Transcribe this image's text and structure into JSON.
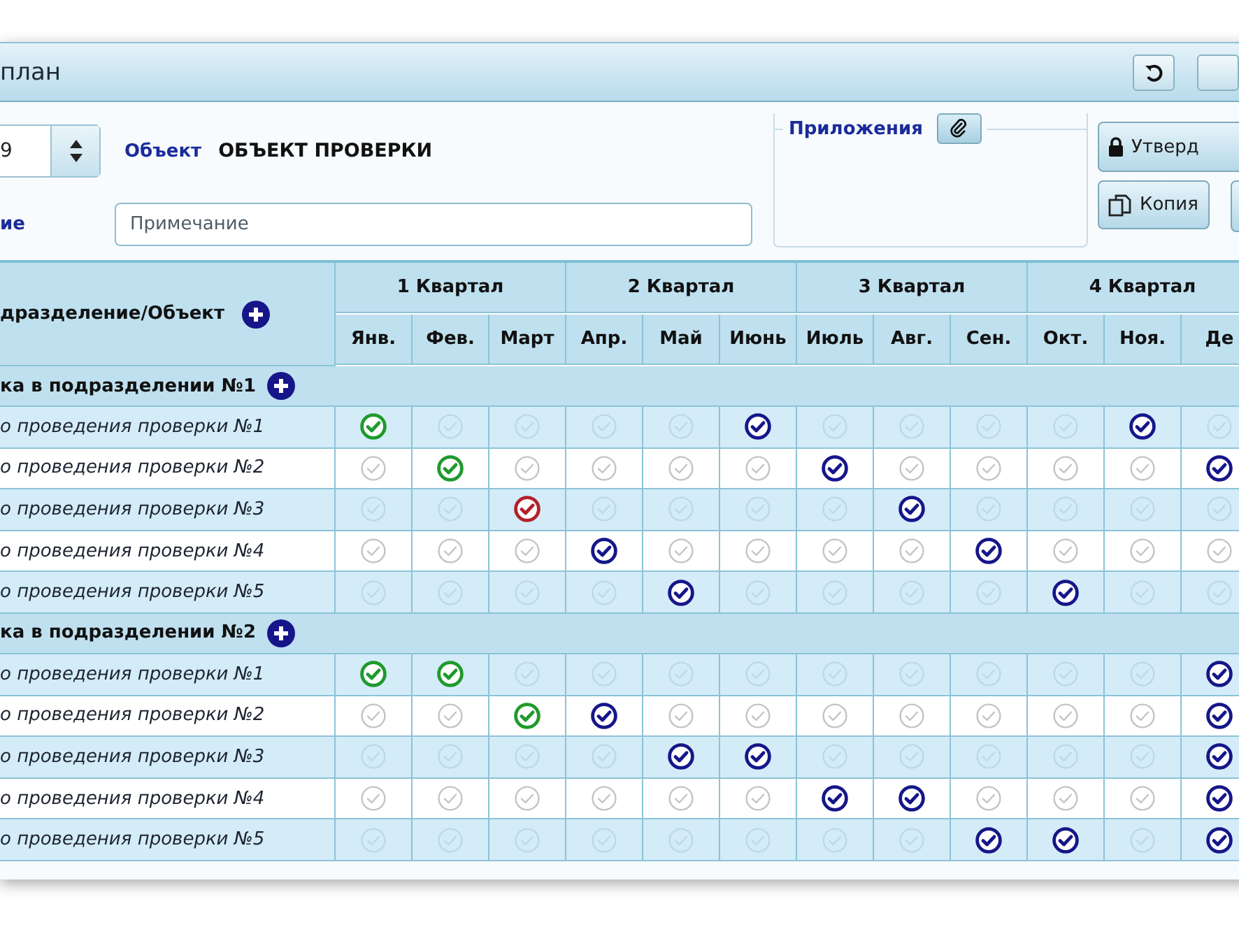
{
  "window": {
    "title": "план"
  },
  "form": {
    "year": {
      "value": "9"
    },
    "object": {
      "label": "Объект",
      "value": "ОБЪЕКТ ПРОВЕРКИ"
    },
    "note": {
      "label": "ие",
      "placeholder": "Примечание"
    },
    "attachments": {
      "label": "Приложения"
    },
    "actions": [
      {
        "label": "Утверд"
      },
      {
        "label": "Копия"
      }
    ]
  },
  "table": {
    "first_column": "дразделение/Объект",
    "quarters": [
      {
        "label": "1 Квартал",
        "months": [
          "Янв.",
          "Фев.",
          "Март"
        ]
      },
      {
        "label": "2 Квартал",
        "months": [
          "Апр.",
          "Май",
          "Июнь"
        ]
      },
      {
        "label": "3 Квартал",
        "months": [
          "Июль",
          "Авг.",
          "Сен."
        ]
      },
      {
        "label": "4 Квартал",
        "months": [
          "Окт.",
          "Ноя.",
          "Де"
        ]
      }
    ],
    "groups": [
      {
        "title": "ка в подразделении №1",
        "rows": [
          {
            "name": "о проведения проверки №1",
            "cells": [
              {
                "checked": true,
                "color": "#1f9a2c"
              },
              {
                "checked": false
              },
              {
                "checked": false
              },
              {
                "checked": false
              },
              {
                "checked": false
              },
              {
                "checked": true,
                "color": "#16168a"
              },
              {
                "checked": false
              },
              {
                "checked": false
              },
              {
                "checked": false
              },
              {
                "checked": false
              },
              {
                "checked": true,
                "color": "#16168a"
              },
              {
                "checked": false
              }
            ]
          },
          {
            "name": "о проведения проверки №2",
            "cells": [
              {
                "checked": false
              },
              {
                "checked": true,
                "color": "#1f9a2c"
              },
              {
                "checked": false
              },
              {
                "checked": false
              },
              {
                "checked": false
              },
              {
                "checked": false
              },
              {
                "checked": true,
                "color": "#16168a"
              },
              {
                "checked": false
              },
              {
                "checked": false
              },
              {
                "checked": false
              },
              {
                "checked": false
              },
              {
                "checked": true,
                "color": "#16168a"
              }
            ]
          },
          {
            "name": "о проведения проверки №3",
            "cells": [
              {
                "checked": false
              },
              {
                "checked": false
              },
              {
                "checked": true,
                "color": "#b3202a"
              },
              {
                "checked": false
              },
              {
                "checked": false
              },
              {
                "checked": false
              },
              {
                "checked": false
              },
              {
                "checked": true,
                "color": "#16168a"
              },
              {
                "checked": false
              },
              {
                "checked": false
              },
              {
                "checked": false
              },
              {
                "checked": false
              }
            ]
          },
          {
            "name": "о проведения проверки №4",
            "cells": [
              {
                "checked": false
              },
              {
                "checked": false
              },
              {
                "checked": false
              },
              {
                "checked": true,
                "color": "#16168a"
              },
              {
                "checked": false
              },
              {
                "checked": false
              },
              {
                "checked": false
              },
              {
                "checked": false
              },
              {
                "checked": true,
                "color": "#16168a"
              },
              {
                "checked": false
              },
              {
                "checked": false
              },
              {
                "checked": false
              }
            ]
          },
          {
            "name": "о проведения проверки №5",
            "cells": [
              {
                "checked": false
              },
              {
                "checked": false
              },
              {
                "checked": false
              },
              {
                "checked": false
              },
              {
                "checked": true,
                "color": "#16168a"
              },
              {
                "checked": false
              },
              {
                "checked": false
              },
              {
                "checked": false
              },
              {
                "checked": false
              },
              {
                "checked": true,
                "color": "#16168a"
              },
              {
                "checked": false
              },
              {
                "checked": false
              }
            ]
          }
        ]
      },
      {
        "title": "ка в подразделении №2",
        "rows": [
          {
            "name": "о проведения проверки №1",
            "cells": [
              {
                "checked": true,
                "color": "#1f9a2c"
              },
              {
                "checked": true,
                "color": "#1f9a2c"
              },
              {
                "checked": false
              },
              {
                "checked": false
              },
              {
                "checked": false
              },
              {
                "checked": false
              },
              {
                "checked": false
              },
              {
                "checked": false
              },
              {
                "checked": false
              },
              {
                "checked": false
              },
              {
                "checked": false
              },
              {
                "checked": true,
                "color": "#16168a"
              }
            ]
          },
          {
            "name": "о проведения проверки №2",
            "cells": [
              {
                "checked": false
              },
              {
                "checked": false
              },
              {
                "checked": true,
                "color": "#1f9a2c"
              },
              {
                "checked": true,
                "color": "#16168a"
              },
              {
                "checked": false
              },
              {
                "checked": false
              },
              {
                "checked": false
              },
              {
                "checked": false
              },
              {
                "checked": false
              },
              {
                "checked": false
              },
              {
                "checked": false
              },
              {
                "checked": true,
                "color": "#16168a"
              }
            ]
          },
          {
            "name": "о проведения проверки №3",
            "cells": [
              {
                "checked": false
              },
              {
                "checked": false
              },
              {
                "checked": false
              },
              {
                "checked": false
              },
              {
                "checked": true,
                "color": "#16168a"
              },
              {
                "checked": true,
                "color": "#16168a"
              },
              {
                "checked": false
              },
              {
                "checked": false
              },
              {
                "checked": false
              },
              {
                "checked": false
              },
              {
                "checked": false
              },
              {
                "checked": true,
                "color": "#16168a"
              }
            ]
          },
          {
            "name": "о проведения проверки №4",
            "cells": [
              {
                "checked": false
              },
              {
                "checked": false
              },
              {
                "checked": false
              },
              {
                "checked": false
              },
              {
                "checked": false
              },
              {
                "checked": false
              },
              {
                "checked": true,
                "color": "#16168a"
              },
              {
                "checked": true,
                "color": "#16168a"
              },
              {
                "checked": false
              },
              {
                "checked": false
              },
              {
                "checked": false
              },
              {
                "checked": true,
                "color": "#16168a"
              }
            ]
          },
          {
            "name": "о проведения проверки №5",
            "cells": [
              {
                "checked": false
              },
              {
                "checked": false
              },
              {
                "checked": false
              },
              {
                "checked": false
              },
              {
                "checked": false
              },
              {
                "checked": false
              },
              {
                "checked": false
              },
              {
                "checked": false
              },
              {
                "checked": true,
                "color": "#16168a"
              },
              {
                "checked": true,
                "color": "#16168a"
              },
              {
                "checked": false
              },
              {
                "checked": true,
                "color": "#16168a"
              }
            ]
          }
        ]
      }
    ]
  }
}
